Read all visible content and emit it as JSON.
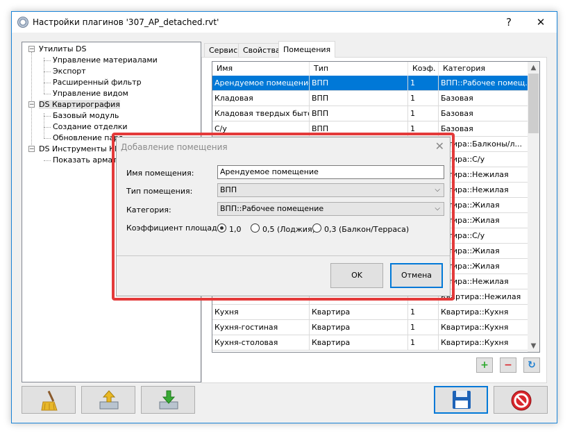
{
  "window": {
    "title": "Настройки плагинов '307_AP_detached.rvt'",
    "help_label": "?",
    "close_label": "✕"
  },
  "tree": {
    "groups": [
      {
        "label": "Утилиты DS",
        "expander": "−",
        "children": [
          "Управление материалами",
          "Экспорт",
          "Расширенный фильтр",
          "Управление видом"
        ]
      },
      {
        "label": "DS Квартирография",
        "expander": "−",
        "children": [
          "Базовый модуль",
          "Создание отделки",
          "Обновление пара..."
        ]
      },
      {
        "label": "DS Инструменты КР",
        "expander": "−",
        "children": [
          "Показать армату..."
        ]
      }
    ]
  },
  "tabs": [
    "Сервис",
    "Свойства",
    "Помещения"
  ],
  "active_tab": "Помещения",
  "grid": {
    "columns": [
      "Имя",
      "Тип",
      "Коэф.",
      "Категория"
    ],
    "rows": [
      [
        "Арендуемое помещение",
        "ВПП",
        "1",
        "ВПП::Рабочее помещ..."
      ],
      [
        "Кладовая",
        "ВПП",
        "1",
        "Базовая"
      ],
      [
        "Кладовая твердых быто...",
        "ВПП",
        "1",
        "Базовая"
      ],
      [
        "С/у",
        "ВПП",
        "1",
        "Базовая"
      ],
      [
        "",
        "",
        "",
        "...тира::Балконы/л..."
      ],
      [
        "",
        "",
        "",
        "...тира::С/у"
      ],
      [
        "",
        "",
        "",
        "...тира::Нежилая"
      ],
      [
        "",
        "",
        "",
        "...тира::Нежилая"
      ],
      [
        "",
        "",
        "",
        "...тира::Жилая"
      ],
      [
        "",
        "",
        "",
        "...тира::Жилая"
      ],
      [
        "",
        "",
        "",
        "...тира::С/у"
      ],
      [
        "",
        "",
        "",
        "...тира::Жилая"
      ],
      [
        "",
        "",
        "",
        "...тира::Жилая"
      ],
      [
        "",
        "",
        "",
        "...тира::Нежилая"
      ],
      [
        "",
        "",
        "",
        "Квартира::Нежилая"
      ],
      [
        "Кухня",
        "Квартира",
        "1",
        "Квартира::Кухня"
      ],
      [
        "Кухня-гостиная",
        "Квартира",
        "1",
        "Квартира::Кухня"
      ],
      [
        "Кухня-столовая",
        "Квартира",
        "1",
        "Квартира::Кухня"
      ]
    ],
    "selected_row": 0
  },
  "grid_buttons": {
    "add": "+",
    "remove": "−",
    "refresh": "↻"
  },
  "dialog": {
    "title": "Добавление помещения",
    "close_label": "✕",
    "name_label": "Имя помещения:",
    "name_value": "Арендуемое помещение",
    "type_label": "Тип помещения:",
    "type_value": "ВПП",
    "category_label": "Категория:",
    "category_value": "ВПП::Рабочее помещение",
    "coef_label": "Коэффициент площади:",
    "coef_options": [
      "1,0",
      "0,5 (Лоджия)",
      "0,3 (Балкон/Терраса)"
    ],
    "coef_selected": 0,
    "ok_label": "OK",
    "cancel_label": "Отмена"
  },
  "icons": {
    "broom": "broom-icon",
    "import": "import-icon",
    "export": "export-icon",
    "save": "save-icon",
    "cancel": "cancel-icon"
  },
  "colors": {
    "accent": "#0078d7",
    "highlight_frame": "#e33a3a",
    "add_green": "#2ba82b",
    "remove_red": "#d9262c"
  }
}
